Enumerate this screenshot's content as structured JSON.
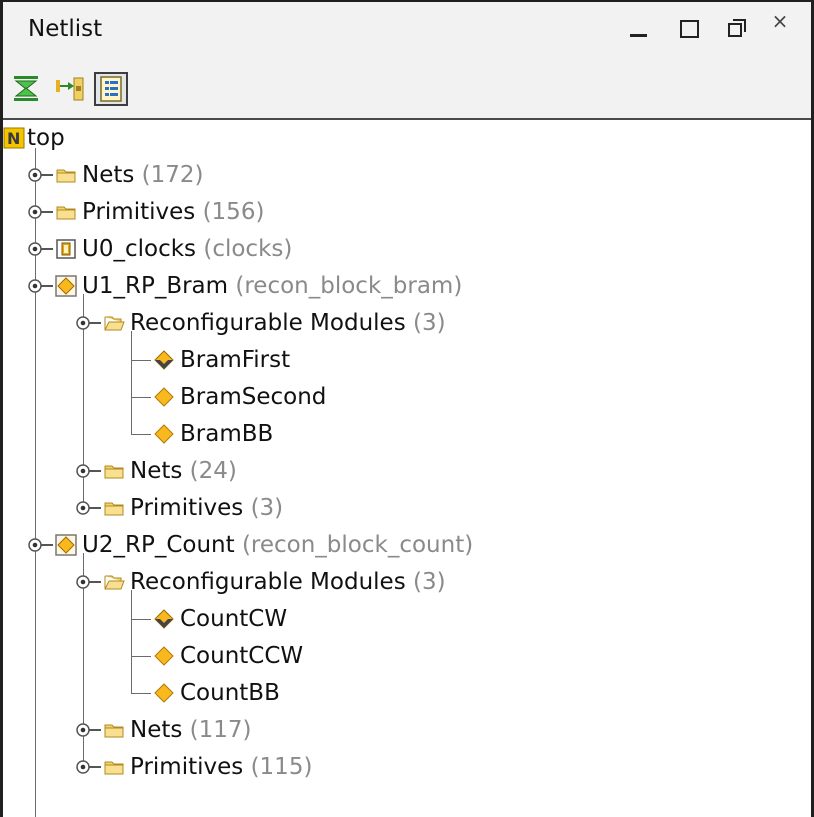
{
  "panel": {
    "title": "Netlist",
    "controls": {
      "minimize": "minimize-icon",
      "maximize": "maximize-icon",
      "restore": "restore-icon",
      "close": "×"
    }
  },
  "toolbar": {
    "buttons": [
      {
        "name": "collapse-all-icon",
        "active": false
      },
      {
        "name": "expand-all-icon",
        "active": false
      },
      {
        "name": "show-hierarchy-icon",
        "active": true
      }
    ]
  },
  "colors": {
    "folder": "#f4d46a",
    "diamond": "#f9b91e",
    "active_diamond_dark": "#444444",
    "meta_text": "#8a8a8a"
  },
  "tree": {
    "root": {
      "label": "top",
      "icon": "netlist-n-icon"
    },
    "rows": [
      {
        "name": "Nets",
        "meta": "(172)"
      },
      {
        "name": "Primitives",
        "meta": "(156)"
      },
      {
        "name": "U0_clocks",
        "meta": "(clocks)"
      },
      {
        "name": "U1_RP_Bram",
        "meta": "(recon_block_bram)"
      },
      {
        "name": "Reconfigurable Modules",
        "meta": "(3)"
      },
      {
        "name": "BramFirst",
        "meta": ""
      },
      {
        "name": "BramSecond",
        "meta": ""
      },
      {
        "name": "BramBB",
        "meta": ""
      },
      {
        "name": "Nets",
        "meta": "(24)"
      },
      {
        "name": "Primitives",
        "meta": "(3)"
      },
      {
        "name": "U2_RP_Count",
        "meta": "(recon_block_count)"
      },
      {
        "name": "Reconfigurable Modules",
        "meta": "(3)"
      },
      {
        "name": "CountCW",
        "meta": ""
      },
      {
        "name": "CountCCW",
        "meta": ""
      },
      {
        "name": "CountBB",
        "meta": ""
      },
      {
        "name": "Nets",
        "meta": "(117)"
      },
      {
        "name": "Primitives",
        "meta": "(115)"
      }
    ]
  }
}
